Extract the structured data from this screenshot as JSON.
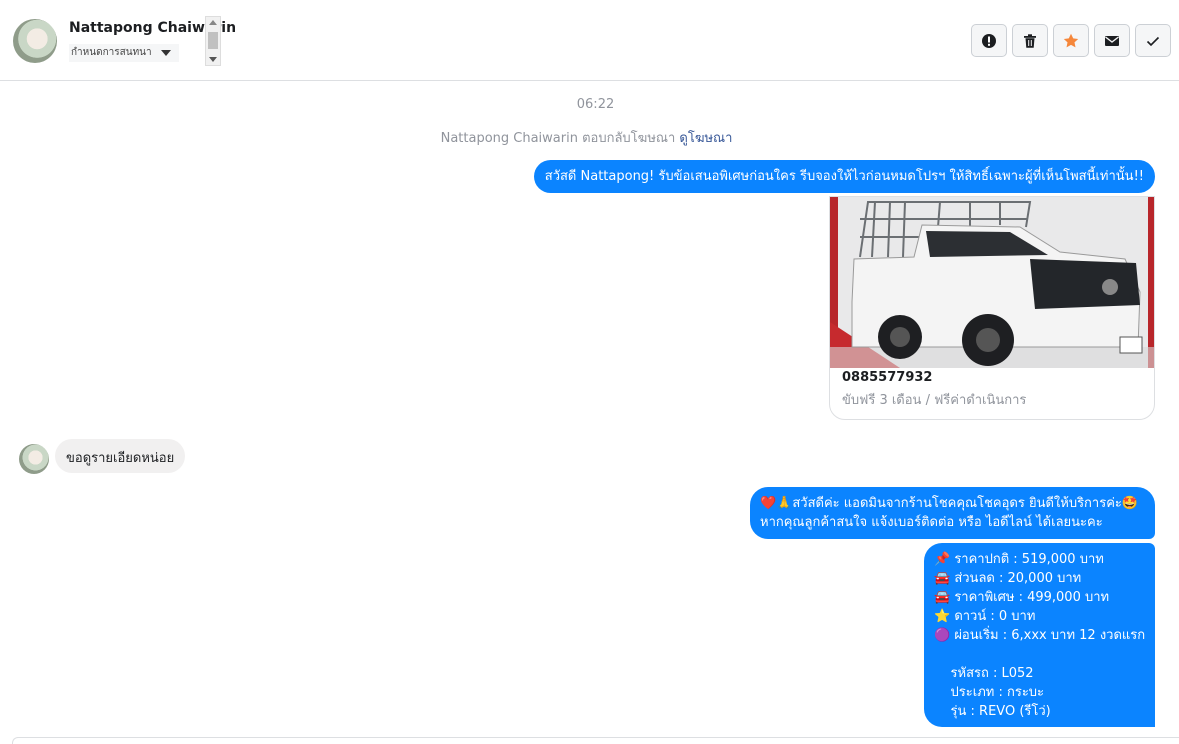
{
  "header": {
    "contact_name": "Nattapong Chaiwarin",
    "conversation_label": "กำหนดการสนทนา",
    "actions": [
      {
        "name": "report-button",
        "icon": "exclamation-circle-icon",
        "color": "#1c1e21"
      },
      {
        "name": "delete-button",
        "icon": "trash-icon",
        "color": "#1c1e21"
      },
      {
        "name": "star-button",
        "icon": "star-icon",
        "color": "#f5873b"
      },
      {
        "name": "mark-unread-button",
        "icon": "envelope-icon",
        "color": "#1c1e21"
      },
      {
        "name": "mark-done-button",
        "icon": "check-icon",
        "color": "#1c1e21"
      }
    ]
  },
  "thread": {
    "timestamp": "06:22",
    "ad_reply_text": "Nattapong Chaiwarin ตอบกลับโฆษณา",
    "ad_reply_link": "ดูโฆษณา",
    "msg_greeting": "สวัสดี Nattapong! รับข้อเสนอพิเศษก่อนใคร รีบจองให้ไวก่อนหมดโปรฯ ให้สิทธิ์เฉพาะผู้ที่เห็นโพสนี้เท่านั้น!!",
    "ad_card": {
      "phone": "0885577932",
      "subtitle": "ขับฟรี 3 เดือน / ฟรีค่าดำเนินการ"
    },
    "incoming_message": "ขอดูรายเอียดหน่อย",
    "msg_admin": "❤️🙏สวัสดีค่ะ แอดมินจากร้านโชคคุณโชคอุดร ยินดีให้บริการค่ะ🤩 หากคุณลูกค้าสนใจ แจ้งเบอร์ติดต่อ หรือ ไอดีไลน์ ได้เลยนะคะ",
    "msg_details": "📌 ราคาปกติ : 519,000 บาท\n🚘 ส่วนลด : 20,000 บาท\n🚘 ราคาพิเศษ : 499,000 บาท\n⭐ ดาวน์ : 0 บาท\n🟣 ผ่อนเริ่ม : 6,xxx บาท 12 งวดแรก\n\n    รหัสรถ : L052\n    ประเภท : กระบะ\n    รุ่น : REVO (รีโว่)"
  },
  "colors": {
    "outgoing_bubble": "#0b84ff",
    "incoming_bubble": "#f1f0f0",
    "link": "#385898"
  }
}
